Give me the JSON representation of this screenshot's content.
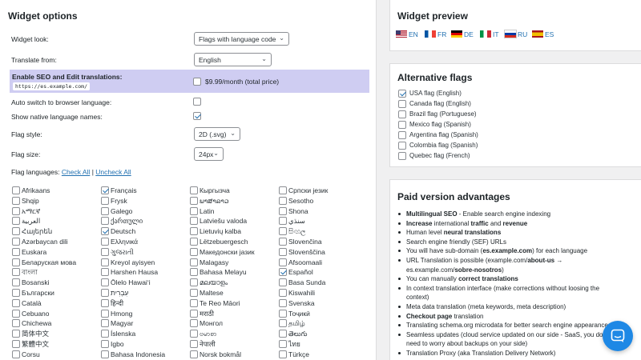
{
  "options": {
    "title": "Widget options",
    "widget_look_label": "Widget look:",
    "widget_look_value": "Flags with language code",
    "translate_from_label": "Translate from:",
    "translate_from_value": "English",
    "seo_label": "Enable SEO and Edit translations:",
    "seo_url": "https://es.example.com/",
    "seo_price": "$9.99/month (total price)",
    "auto_switch_label": "Auto switch to browser language:",
    "native_names_label": "Show native language names:",
    "flag_style_label": "Flag style:",
    "flag_style_value": "2D (.svg)",
    "flag_size_label": "Flag size:",
    "flag_size_value": "24px",
    "flag_languages_label": "Flag languages:",
    "check_all": "Check All",
    "separator": "|",
    "uncheck_all": "Uncheck All"
  },
  "languages": [
    [
      {
        "name": "Afrikaans",
        "checked": false
      },
      {
        "name": "Shqip",
        "checked": false
      },
      {
        "name": "አማርኛ",
        "checked": false
      },
      {
        "name": "العربية",
        "checked": false
      },
      {
        "name": "Հայերեն",
        "checked": false
      },
      {
        "name": "Azərbaycan dili",
        "checked": false
      },
      {
        "name": "Euskara",
        "checked": false
      },
      {
        "name": "Беларуская мова",
        "checked": false
      },
      {
        "name": "বাংলা",
        "checked": false
      },
      {
        "name": "Bosanski",
        "checked": false
      },
      {
        "name": "Български",
        "checked": false
      },
      {
        "name": "Català",
        "checked": false
      },
      {
        "name": "Cebuano",
        "checked": false
      },
      {
        "name": "Chichewa",
        "checked": false
      },
      {
        "name": "简体中文",
        "checked": false
      },
      {
        "name": "繁體中文",
        "checked": false
      },
      {
        "name": "Corsu",
        "checked": false
      }
    ],
    [
      {
        "name": "Français",
        "checked": true
      },
      {
        "name": "Frysk",
        "checked": false
      },
      {
        "name": "Galego",
        "checked": false
      },
      {
        "name": "ქართული",
        "checked": false
      },
      {
        "name": "Deutsch",
        "checked": true
      },
      {
        "name": "Ελληνικά",
        "checked": false
      },
      {
        "name": "ગુજરાતી",
        "checked": false
      },
      {
        "name": "Kreyol ayisyen",
        "checked": false
      },
      {
        "name": "Harshen Hausa",
        "checked": false
      },
      {
        "name": "Ōlelo Hawaiʻi",
        "checked": false
      },
      {
        "name": "עִבְרִית",
        "checked": false
      },
      {
        "name": "हिन्दी",
        "checked": false
      },
      {
        "name": "Hmong",
        "checked": false
      },
      {
        "name": "Magyar",
        "checked": false
      },
      {
        "name": "Íslenska",
        "checked": false
      },
      {
        "name": "Igbo",
        "checked": false
      },
      {
        "name": "Bahasa Indonesia",
        "checked": false
      }
    ],
    [
      {
        "name": "Кыргызча",
        "checked": false
      },
      {
        "name": "ພາສາລາວ",
        "checked": false
      },
      {
        "name": "Latin",
        "checked": false
      },
      {
        "name": "Latviešu valoda",
        "checked": false
      },
      {
        "name": "Lietuvių kalba",
        "checked": false
      },
      {
        "name": "Lëtzebuergesch",
        "checked": false
      },
      {
        "name": "Македонски јазик",
        "checked": false
      },
      {
        "name": "Malagasy",
        "checked": false
      },
      {
        "name": "Bahasa Melayu",
        "checked": false
      },
      {
        "name": "മലയാളം",
        "checked": false
      },
      {
        "name": "Maltese",
        "checked": false
      },
      {
        "name": "Te Reo Māori",
        "checked": false
      },
      {
        "name": "मराठी",
        "checked": false
      },
      {
        "name": "Монгол",
        "checked": false
      },
      {
        "name": "ဗမာစာ",
        "checked": false
      },
      {
        "name": "नेपाली",
        "checked": false
      },
      {
        "name": "Norsk bokmål",
        "checked": false
      }
    ],
    [
      {
        "name": "Српски језик",
        "checked": false
      },
      {
        "name": "Sesotho",
        "checked": false
      },
      {
        "name": "Shona",
        "checked": false
      },
      {
        "name": "سنڌي",
        "checked": false
      },
      {
        "name": "සිංහල",
        "checked": false
      },
      {
        "name": "Slovenčina",
        "checked": false
      },
      {
        "name": "Slovenščina",
        "checked": false
      },
      {
        "name": "Afsoomaali",
        "checked": false
      },
      {
        "name": "Español",
        "checked": true
      },
      {
        "name": "Basa Sunda",
        "checked": false
      },
      {
        "name": "Kiswahili",
        "checked": false
      },
      {
        "name": "Svenska",
        "checked": false
      },
      {
        "name": "Тоҷикӣ",
        "checked": false
      },
      {
        "name": "தமிழ்",
        "checked": false
      },
      {
        "name": "తెలుగు",
        "checked": false
      },
      {
        "name": "ไทย",
        "checked": false
      },
      {
        "name": "Türkçe",
        "checked": false
      }
    ]
  ],
  "preview": {
    "title": "Widget preview",
    "flags": [
      {
        "code": "EN",
        "flag": "usa-flag-icon"
      },
      {
        "code": "FR",
        "flag": "france-flag-icon"
      },
      {
        "code": "DE",
        "flag": "germany-flag-icon"
      },
      {
        "code": "IT",
        "flag": "italy-flag-icon"
      },
      {
        "code": "RU",
        "flag": "russia-flag-icon"
      },
      {
        "code": "ES",
        "flag": "spain-flag-icon"
      }
    ]
  },
  "alternative": {
    "title": "Alternative flags",
    "items": [
      {
        "label": "USA flag (English)",
        "checked": true
      },
      {
        "label": "Canada flag (English)",
        "checked": false
      },
      {
        "label": "Brazil flag (Portuguese)",
        "checked": false
      },
      {
        "label": "Mexico flag (Spanish)",
        "checked": false
      },
      {
        "label": "Argentina flag (Spanish)",
        "checked": false
      },
      {
        "label": "Colombia flag (Spanish)",
        "checked": false
      },
      {
        "label": "Quebec flag (French)",
        "checked": false
      }
    ]
  },
  "paid": {
    "title": "Paid version advantages",
    "items": [
      [
        "Multilingual SEO",
        " - Enable search engine indexing"
      ],
      [
        "Increase",
        " international ",
        "traffic",
        " and ",
        "revenue"
      ],
      [
        "Human level ",
        "neural translations"
      ],
      [
        "Search engine friendly (SEF) URLs"
      ],
      [
        "You will have sub-domain (",
        "es.example.com",
        ") for each language"
      ],
      [
        "URL Translation is possible (example.com/",
        "about-us",
        " →"
      ],
      [
        "es.example.com/",
        "sobre-nosotros",
        ")"
      ],
      [
        "You can manually ",
        "correct translations"
      ],
      [
        "In context translation interface (make corrections without loosing the"
      ],
      [
        "context)"
      ],
      [
        "Meta data translation (meta keywords, meta description)"
      ],
      [
        "Checkout page",
        " translation"
      ],
      [
        "Translating schema.org microdata for better search engine appearance"
      ],
      [
        "Seamless updates (cloud service updated on our side - SaaS, you don't"
      ],
      [
        "need to worry about backups on your side)"
      ],
      [
        "Translation Proxy (aka Translation Delivery Network)"
      ]
    ]
  },
  "colors": {
    "accent": "#2271b1",
    "seo_highlight": "#cfcdf2",
    "chat_button": "#1e88e5"
  },
  "chat_icon": "chat-bubble-icon"
}
